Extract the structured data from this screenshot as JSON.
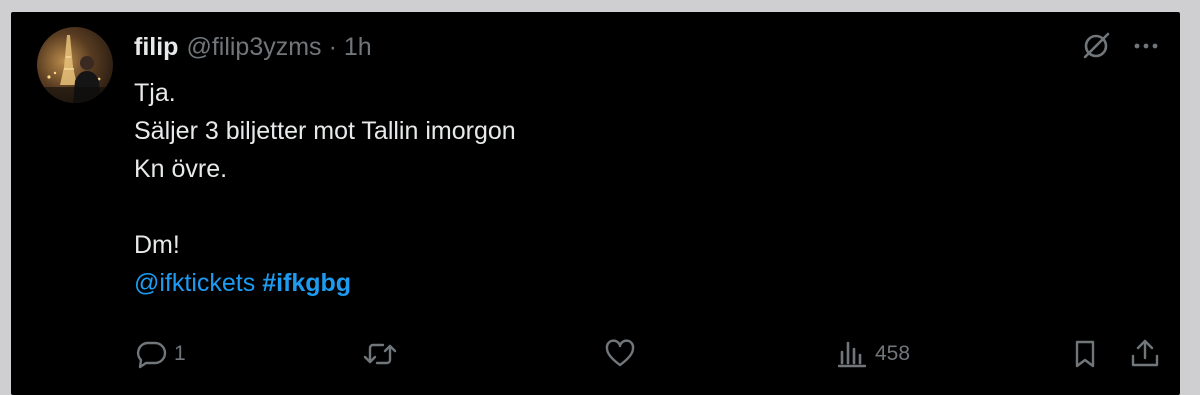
{
  "tweet": {
    "display_name": "filip",
    "handle": "@filip3yzms",
    "separator": "·",
    "time": "1h",
    "lines": [
      "Tja.",
      "Säljer 3 biljetter mot Tallin imorgon",
      "Kn övre.",
      "",
      "Dm!"
    ],
    "mention": "@ifktickets",
    "hashtag": "#ifkgbg"
  },
  "actions": {
    "reply_count": "1",
    "retweet_count": "",
    "like_count": "",
    "view_count": "458"
  },
  "icons": {
    "grok": "grok-icon",
    "more": "more-icon",
    "reply": "reply-icon",
    "retweet": "retweet-icon",
    "like": "like-icon",
    "views": "views-icon",
    "bookmark": "bookmark-icon",
    "share": "share-icon"
  },
  "colors": {
    "background": "#000000",
    "text": "#e7e9ea",
    "muted": "#71767b",
    "link": "#1d9bf0"
  }
}
